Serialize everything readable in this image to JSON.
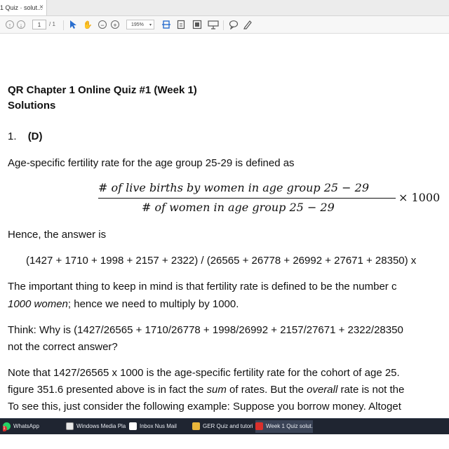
{
  "tab": {
    "title": "1 Quiz · solut...",
    "close": "×"
  },
  "toolbar": {
    "page_current": "1",
    "page_total": "/ 1",
    "zoom": "195%",
    "zoom_caret": "▾"
  },
  "document": {
    "title_line1": "QR Chapter 1 Online Quiz #1 (Week 1)",
    "title_line2": "Solutions",
    "q_number": "1.",
    "q_answer": "(D)",
    "p_definition": "Age-specific fertility rate for the age group 25-29 is defined as",
    "formula": {
      "numerator": "# of live births by women in age group 25 − 29",
      "denominator": "# of women in age group 25 − 29",
      "multiplier": "× 1000"
    },
    "p_hence": "Hence, the answer is",
    "calc": "(1427 + 1710 + 1998 + 2157 + 2322) / (26565 + 26778 + 26992 + 27671 + 28350) x",
    "p_important_1": "The important thing to keep in mind is that fertility rate is defined to be the number c",
    "p_important_2a": "1000 women",
    "p_important_2b": "; hence we need to multiply by 1000.",
    "p_think_1": "Think: Why is (1427/26565 + 1710/26778 + 1998/26992 + 2157/27671 + 2322/28350",
    "p_think_2": "not the correct answer?",
    "p_note_1": "Note that 1427/26565 x 1000 is the age-specific fertility rate for the cohort of age 25.",
    "p_note_2a": "figure 351.6 presented above is in fact the ",
    "p_note_2b": "sum",
    "p_note_2c": " of rates. But the ",
    "p_note_2d": "overall",
    "p_note_2e": " rate is not the",
    "p_note_3": "To see this, just consider the following example: Suppose you borrow money. Altoget"
  },
  "taskbar": {
    "items": [
      {
        "label": "WhatsApp",
        "badge": "1"
      },
      {
        "label": "Windows Media Pla..."
      },
      {
        "label": "Inbox   Nus   Mail"
      },
      {
        "label": "GER Quiz and tutori..."
      },
      {
        "label": "Week 1 Quiz   solut..."
      }
    ]
  },
  "colors": {
    "accent": "#2b6fcf",
    "taskbar": "#1f2531",
    "whatsapp": "#25d366",
    "pdf_red": "#d9302c",
    "folder": "#e9b63b"
  }
}
